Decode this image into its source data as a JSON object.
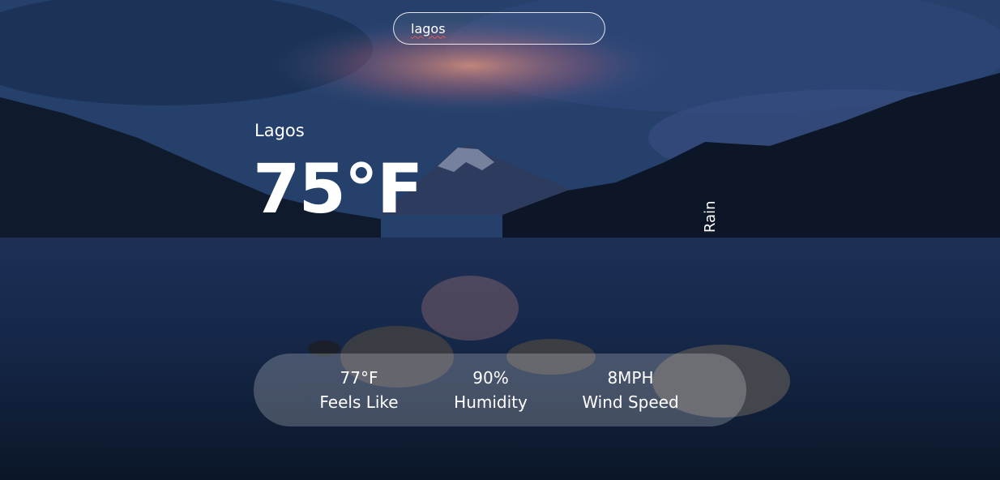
{
  "search": {
    "value": "lagos"
  },
  "weather": {
    "city": "Lagos",
    "temperature": "75°F",
    "description": "Rain"
  },
  "stats": [
    {
      "value": "77°F",
      "label": "Feels Like"
    },
    {
      "value": "90%",
      "label": "Humidity"
    },
    {
      "value": "8MPH",
      "label": "Wind Speed"
    }
  ],
  "colors": {
    "sky": "#2a4a78",
    "glow": "#d98a78",
    "water": "#0e1a2e",
    "pill": "rgba(255,255,255,0.22)"
  }
}
